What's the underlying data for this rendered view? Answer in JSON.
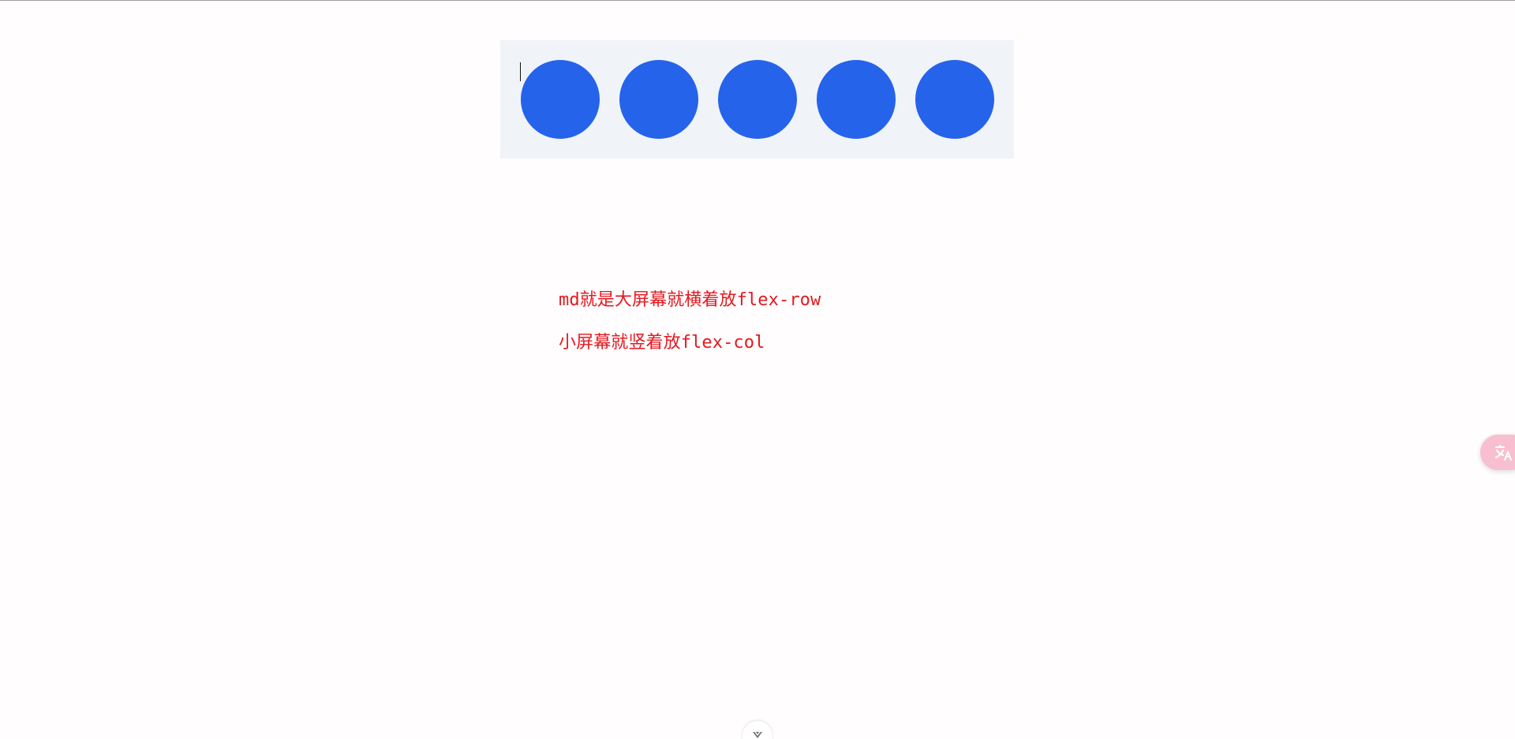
{
  "app": {
    "title": ""
  },
  "demo": {
    "circle_count": 5,
    "circle_color": "#2563eb",
    "panel_color": "#f0f3f8"
  },
  "note": {
    "line_1": "md就是大屏幕就横着放flex-row",
    "line_2": "小屏幕就竖着放flex-col",
    "color": "#e6181e"
  },
  "widgets": {
    "translate_icon": "translate-icon",
    "dock_toggle_icon": "chevron-down-icon",
    "translate_button_color": "#f8bfd1"
  }
}
